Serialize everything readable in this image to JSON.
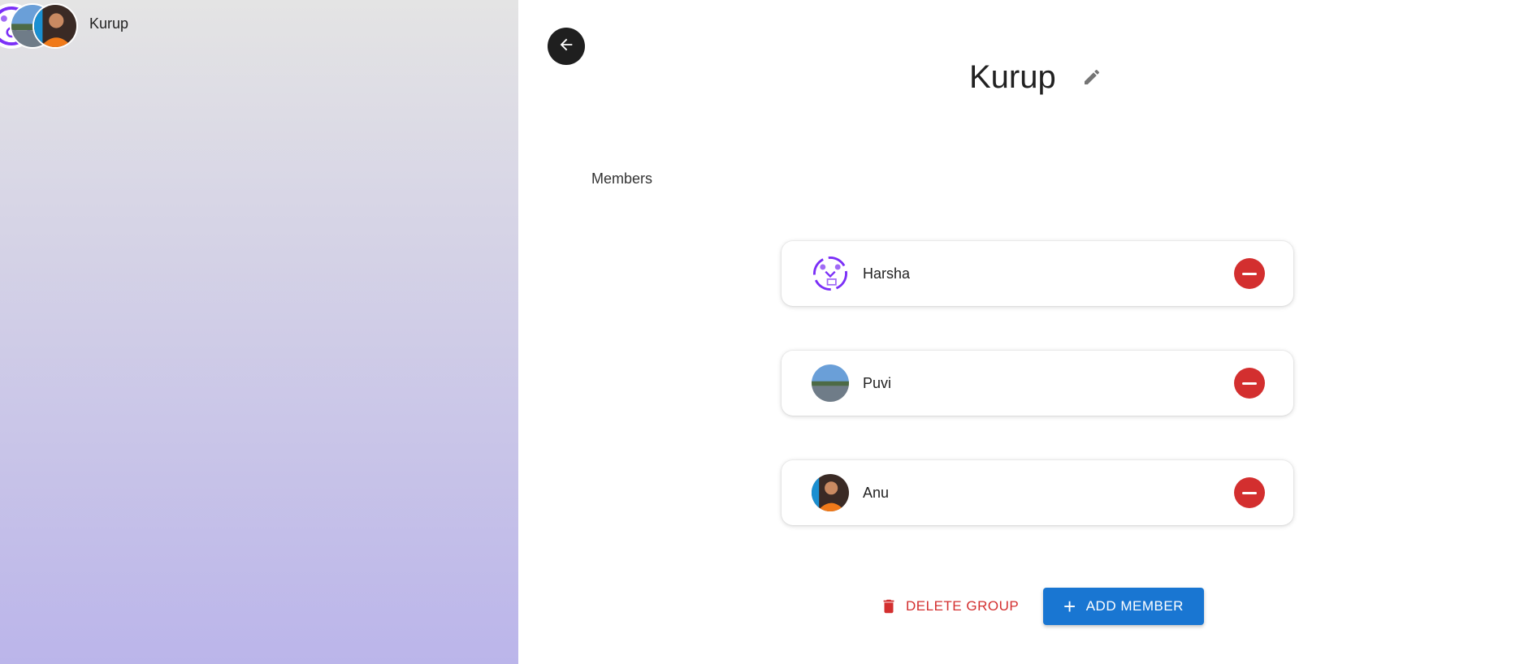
{
  "sidebar": {
    "group": {
      "name": "Kurup",
      "avatars": [
        "purple-logo-avatar",
        "landscape-avatar",
        "portrait-avatar"
      ]
    }
  },
  "main": {
    "title": "Kurup",
    "members_label": "Members",
    "members": [
      {
        "name": "Harsha",
        "avatar": "purple-logo-avatar"
      },
      {
        "name": "Puvi",
        "avatar": "landscape-avatar"
      },
      {
        "name": "Anu",
        "avatar": "portrait-avatar"
      }
    ],
    "delete_label": "DELETE GROUP",
    "add_label": "ADD MEMBER"
  },
  "colors": {
    "primary": "#1976d2",
    "danger": "#d32f2f",
    "sidebar_gradient_top": "#e4e4e4",
    "sidebar_gradient_bottom": "#bbb5ea"
  },
  "icons": {
    "back": "arrow-left-icon",
    "edit": "pencil-icon",
    "remove": "minus-circle-icon",
    "delete": "trash-icon",
    "add": "plus-icon"
  }
}
